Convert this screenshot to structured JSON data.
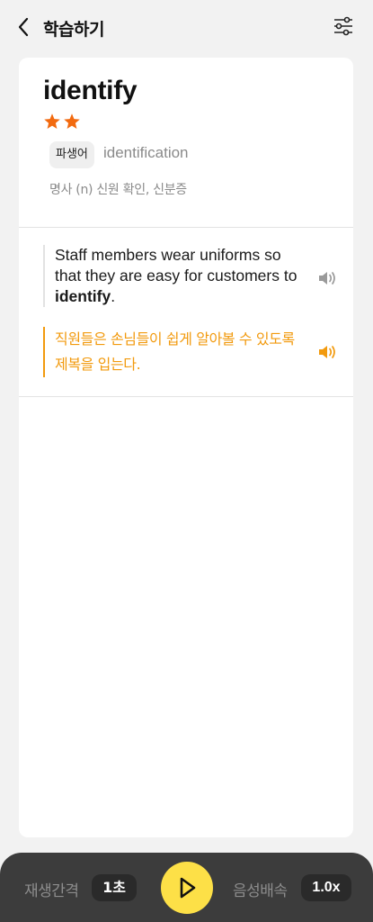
{
  "header": {
    "title": "학습하기",
    "back_icon": "chevron-left-icon",
    "filter_icon": "sliders-icon"
  },
  "word_card": {
    "word": "identify",
    "stars_filled": 2,
    "star_color": "#f26a0f",
    "derivative_tag": "파생어",
    "derivative_word": "identification",
    "meaning": "명사 (n) 신원 확인, 신분증"
  },
  "example": {
    "english_before": "Staff members wear uniforms so that they are easy for customers to ",
    "english_keyword": "identify",
    "english_after": ".",
    "korean": "직원들은 손님들이 쉽게 알아볼 수 있도록 제복을 입는다.",
    "korean_color": "#f29a0e"
  },
  "bottom_bar": {
    "interval_label": "재생간격",
    "interval_value": "1초",
    "speed_label": "음성배속",
    "speed_value": "1.0x",
    "play_color": "#fde047"
  }
}
